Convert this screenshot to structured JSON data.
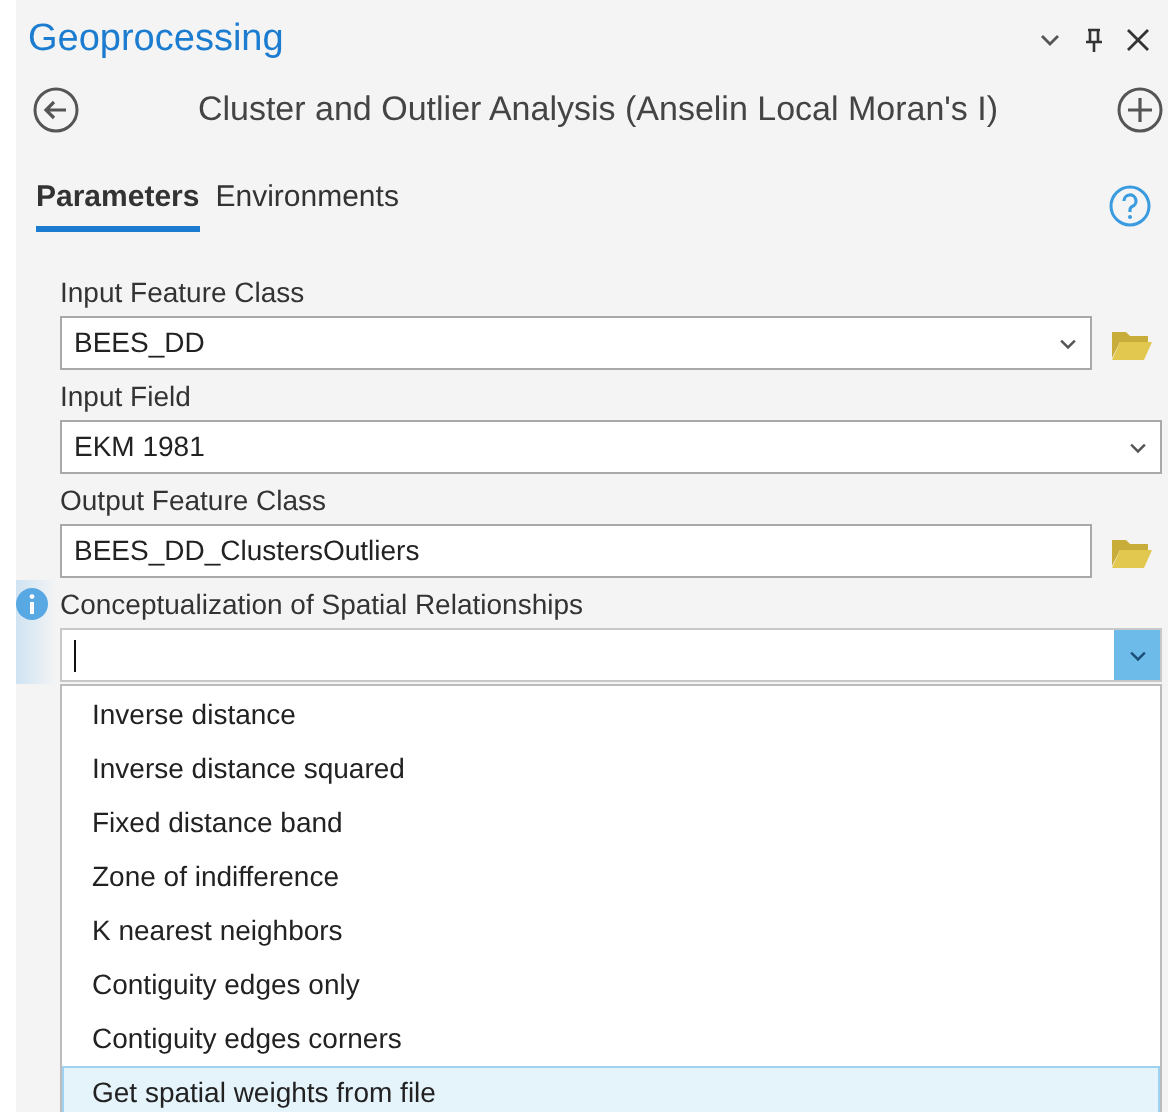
{
  "panel": {
    "title": "Geoprocessing"
  },
  "tool": {
    "title": "Cluster and Outlier Analysis (Anselin Local Moran's I)"
  },
  "tabs": [
    {
      "label": "Parameters",
      "selected": true
    },
    {
      "label": "Environments",
      "selected": false
    }
  ],
  "parameters": [
    {
      "label": "Input Feature Class",
      "value": "BEES_DD",
      "kind": "combo",
      "browse": true,
      "info": false,
      "focused": false
    },
    {
      "label": "Input Field",
      "value": "EKM 1981",
      "kind": "combo",
      "browse": false,
      "info": false,
      "focused": false
    },
    {
      "label": "Output Feature Class",
      "value": "BEES_DD_ClustersOutliers",
      "kind": "text",
      "browse": true,
      "info": false,
      "focused": false
    },
    {
      "label": "Conceptualization of Spatial Relationships",
      "kind": "combo",
      "browse": false,
      "info": true,
      "focused": true,
      "expanded": true,
      "options": [
        {
          "label": "Inverse distance",
          "selected": false
        },
        {
          "label": "Inverse distance squared",
          "selected": false
        },
        {
          "label": "Fixed distance band",
          "selected": false
        },
        {
          "label": "Zone of indifference",
          "selected": false
        },
        {
          "label": "K nearest neighbors",
          "selected": false
        },
        {
          "label": "Contiguity edges only",
          "selected": false
        },
        {
          "label": "Contiguity edges corners",
          "selected": false
        },
        {
          "label": "Get spatial weights from file",
          "selected": true
        }
      ]
    }
  ]
}
